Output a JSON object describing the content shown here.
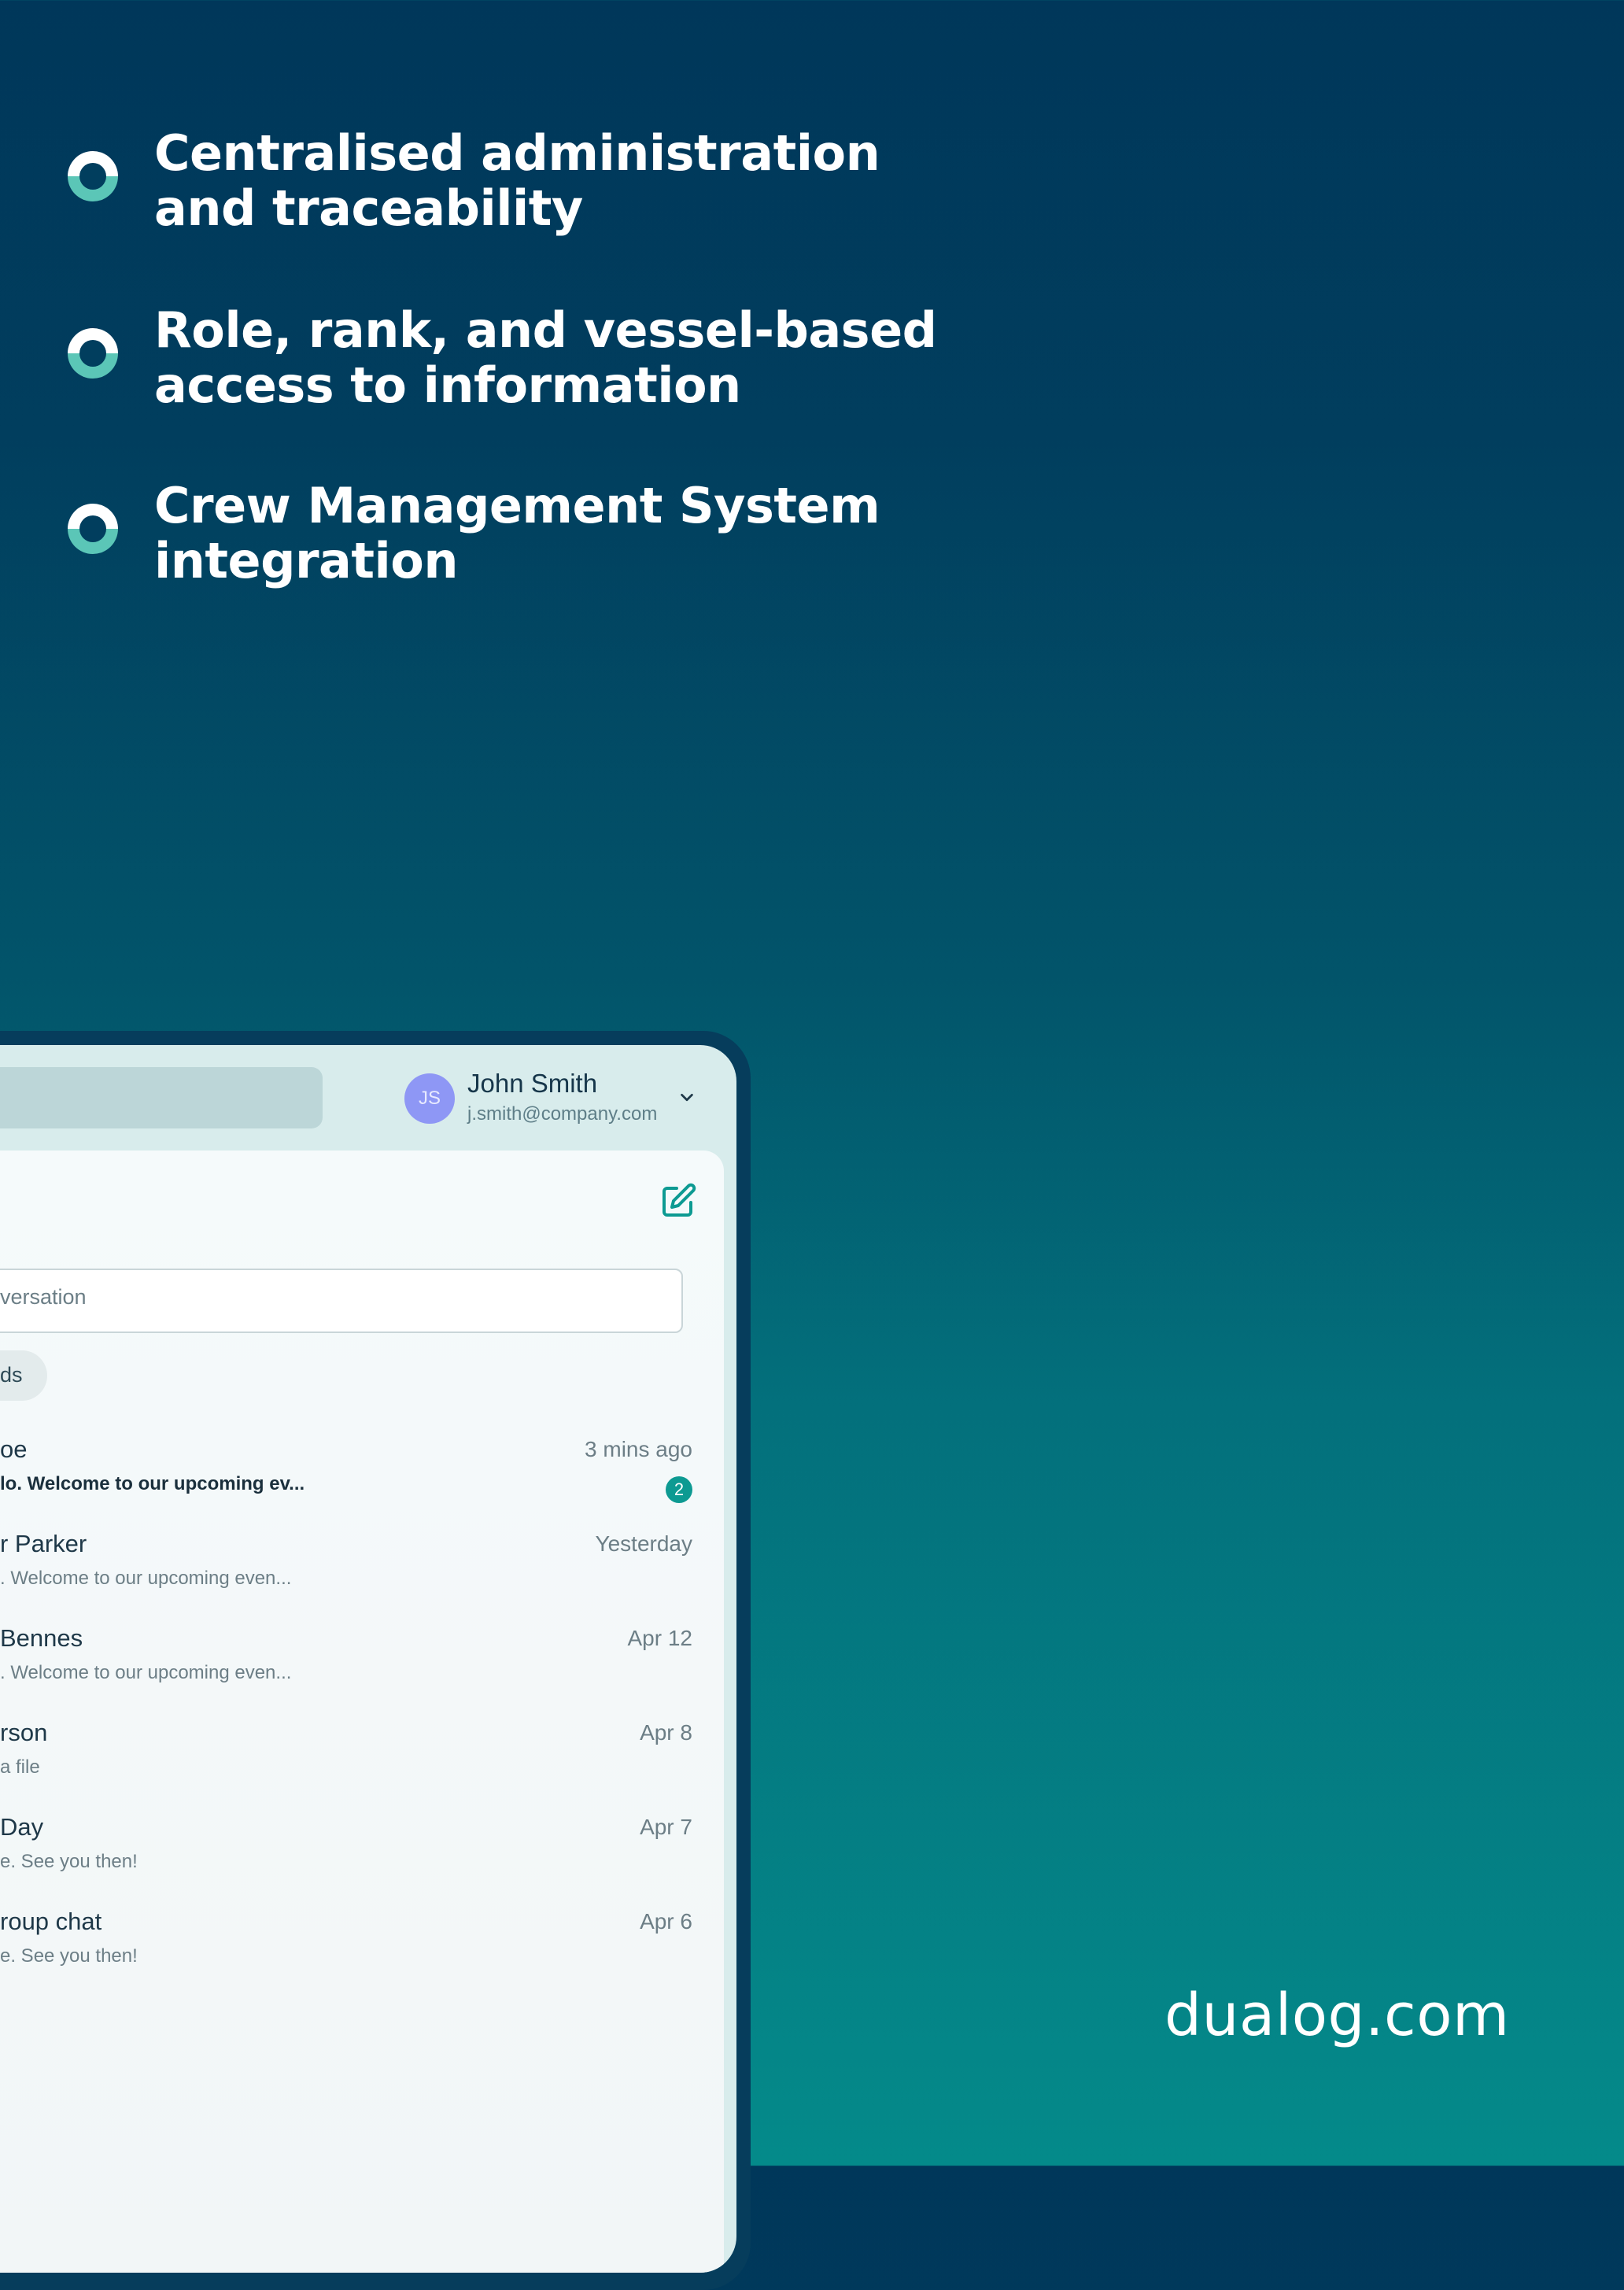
{
  "features": [
    {
      "line1": "Centralised administration",
      "line2": "and traceability"
    },
    {
      "line1": "Role, rank, and vessel-based",
      "line2": "access to information"
    },
    {
      "line1": "Crew Management System",
      "line2": "integration"
    }
  ],
  "website": "dualog.com",
  "app": {
    "user": {
      "initials": "JS",
      "name": "John Smith",
      "email": "j.smith@company.com"
    },
    "search_placeholder": "versation",
    "filter_chip": "ds",
    "conversations": [
      {
        "name": "oe",
        "preview": "lo. Welcome to our upcoming ev...",
        "time": "3 mins ago",
        "unread": "2"
      },
      {
        "name": "r Parker",
        "preview": ". Welcome to our upcoming even...",
        "time": "Yesterday"
      },
      {
        "name": "Bennes",
        "preview": ". Welcome to our upcoming even...",
        "time": "Apr 12"
      },
      {
        "name": "rson",
        "preview": "a file",
        "time": "Apr 8"
      },
      {
        "name": "Day",
        "preview": "e. See you then!",
        "time": "Apr 7"
      },
      {
        "name": "roup chat",
        "preview": "e. See you then!",
        "time": "Apr 6"
      }
    ]
  },
  "colors": {
    "accent": "#0D9A92",
    "ring_teal": "#5BC6B7",
    "avatar": "#8E97F5"
  }
}
